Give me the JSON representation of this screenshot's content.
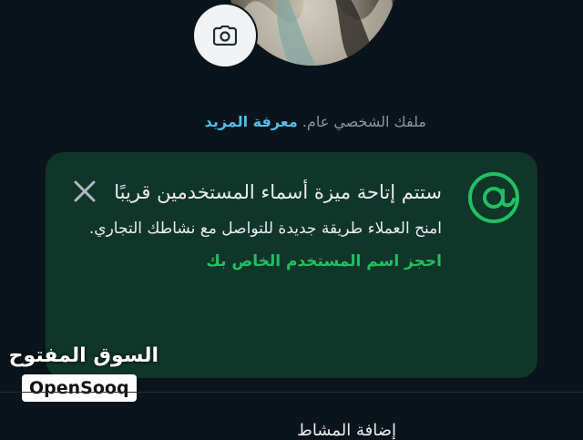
{
  "profile": {
    "info_text": "ملفك الشخصي عام.",
    "learn_more": "معرفة المزيد"
  },
  "card": {
    "title": "ستتم إتاحة ميزة أسماء المستخدمين قريبًا",
    "description": "امنح العملاء طريقة جديدة للتواصل مع نشاطك التجاري.",
    "reserve_link": "احجز اسم المستخدم الخاص بك",
    "icon": "at-icon",
    "close_icon": "close-icon"
  },
  "watermark": {
    "arabic": "السوق المفتوح",
    "brand": "OpenSooq"
  },
  "bottom": {
    "partial_text": "إضافة المشاط"
  },
  "colors": {
    "background": "#0b141a",
    "card": "#103529",
    "accent_green": "#21c063",
    "link_blue": "#53bdeb"
  }
}
